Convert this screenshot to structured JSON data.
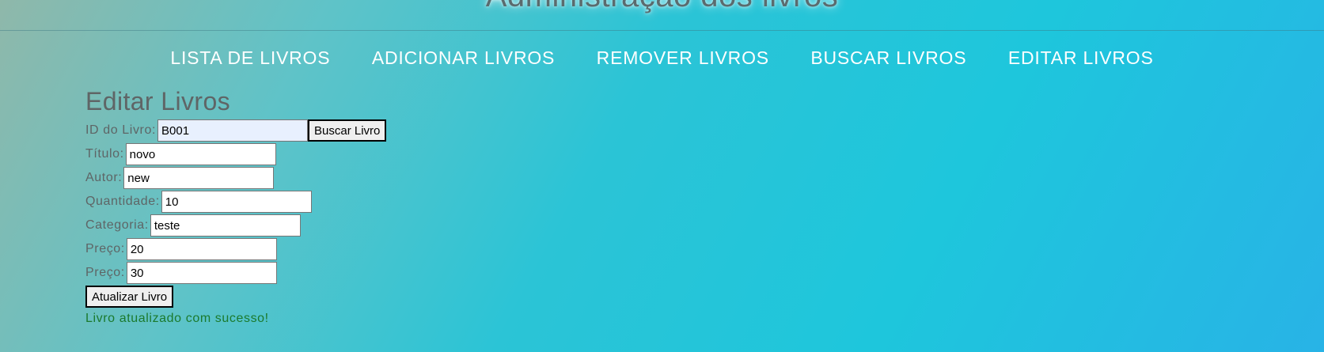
{
  "header": {
    "title": "Administração dos livros"
  },
  "nav": {
    "items": [
      {
        "label": "LISTA DE LIVROS"
      },
      {
        "label": "ADICIONAR LIVROS"
      },
      {
        "label": "REMOVER LIVROS"
      },
      {
        "label": "BUSCAR LIVROS"
      },
      {
        "label": "EDITAR LIVROS"
      }
    ]
  },
  "form": {
    "title": "Editar Livros",
    "id_label": "ID do Livro:",
    "id_value": "B001",
    "search_button": "Buscar Livro",
    "titulo_label": "Título:",
    "titulo_value": "novo",
    "autor_label": "Autor:",
    "autor_value": "new",
    "quantidade_label": "Quantidade:",
    "quantidade_value": "10",
    "categoria_label": "Categoria:",
    "categoria_value": "teste",
    "preco1_label": "Preço:",
    "preco1_value": "20",
    "preco2_label": "Preço:",
    "preco2_value": "30",
    "submit_button": "Atualizar Livro",
    "status_message": "Livro atualizado com sucesso!"
  },
  "colors": {
    "status_success": "#1b7a2d",
    "nav_text": "#ffffff",
    "autofill_bg": "#e8f0fe"
  }
}
